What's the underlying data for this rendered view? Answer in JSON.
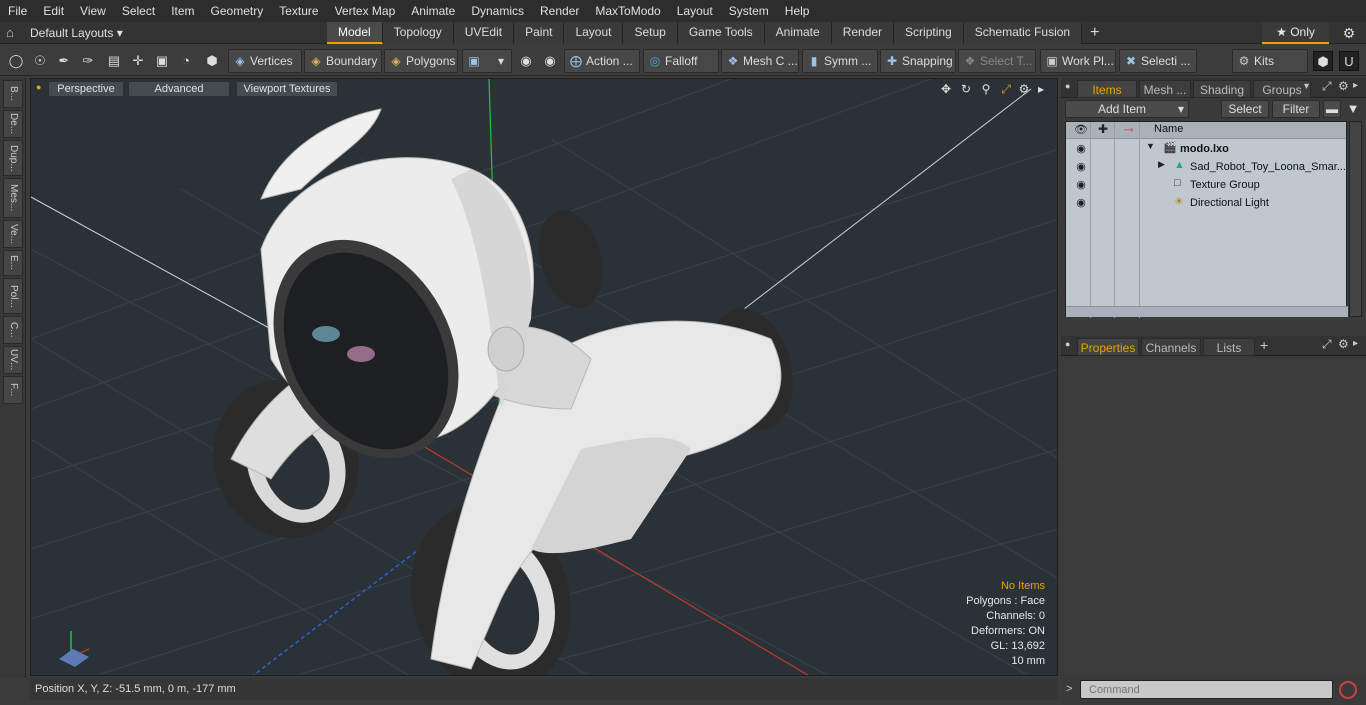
{
  "menu": [
    "File",
    "Edit",
    "View",
    "Select",
    "Item",
    "Geometry",
    "Texture",
    "Vertex Map",
    "Animate",
    "Dynamics",
    "Render",
    "MaxToModo",
    "Layout",
    "System",
    "Help"
  ],
  "layoutbar": {
    "layouts_label": "Default Layouts ▾",
    "tabs": [
      "Model",
      "Topology",
      "UVEdit",
      "Paint",
      "Layout",
      "Setup",
      "Game Tools",
      "Animate",
      "Render",
      "Scripting",
      "Schematic Fusion"
    ],
    "active_tab": "Model",
    "only_label": "★  Only"
  },
  "toolbar": {
    "vertices": "Vertices",
    "boundary": "Boundary",
    "polygons": "Polygons",
    "action": "Action   ...",
    "falloff": "Falloff",
    "mesh": "Mesh C ...",
    "symm": "Symm ...",
    "snapping": "Snapping",
    "select_t": "Select T...",
    "work_plane": "Work Pl...",
    "selecti": "Selecti ...",
    "kits": "Kits"
  },
  "leftstrip": [
    "B...",
    "De...",
    "Dup...",
    "Mes...",
    "Ve...",
    "E...",
    "Pol...",
    "C...",
    "UV...",
    "F..."
  ],
  "viewport": {
    "perspective": "Perspective",
    "advanced": "Advanced",
    "viewport_textures": "Viewport Textures",
    "stats": {
      "no_items": "No Items",
      "polygons": "Polygons : Face",
      "channels": "Channels: 0",
      "deformers": "Deformers: ON",
      "gl": "GL: 13,692",
      "scale": "10 mm"
    }
  },
  "status": {
    "position": "Position X, Y, Z:   -51.5 mm, 0 m, -177 mm"
  },
  "items_panel": {
    "tabs": [
      "Items",
      "Mesh ...",
      "Shading",
      "Groups"
    ],
    "add_item": "Add Item",
    "select": "Select",
    "filter": "Filter",
    "col_name": "Name",
    "rows": [
      {
        "name": "modo.lxo",
        "icon": "scene-icon",
        "bold": true
      },
      {
        "name": "Sad_Robot_Toy_Loona_Smar...",
        "icon": "mesh-icon",
        "bold": false
      },
      {
        "name": "Texture Group",
        "icon": "texture-icon",
        "bold": false
      },
      {
        "name": "Directional Light",
        "icon": "light-icon",
        "bold": false
      }
    ]
  },
  "props_panel": {
    "tabs": [
      "Properties",
      "Channels",
      "Lists"
    ]
  },
  "command": {
    "placeholder": "Command"
  },
  "colors": {
    "accent": "#e6a400",
    "viewport_bg": "#2a3238",
    "x_axis": "#c0392b",
    "y_axis": "#27c23a",
    "z_axis": "#2f5fd0"
  }
}
